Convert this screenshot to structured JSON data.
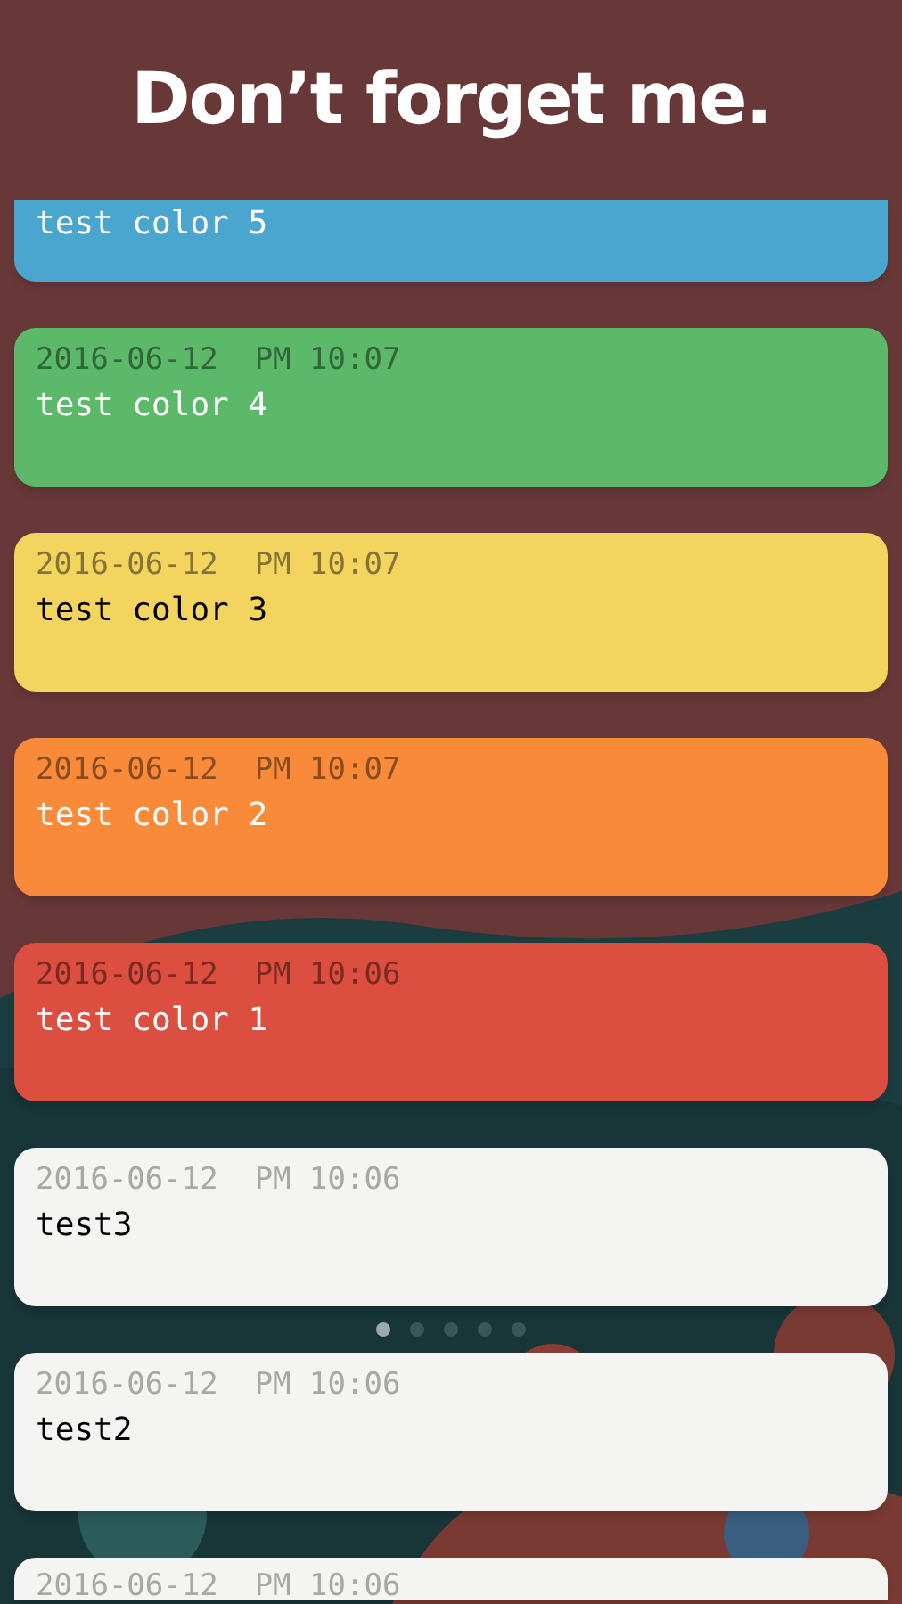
{
  "header": {
    "title": "Don’t forget me."
  },
  "notes": [
    {
      "text": "test color 5",
      "color": "#4ba6cf"
    },
    {
      "date": "2016-06-12  PM 10:07",
      "text": "test color 4",
      "color": "#5cb96a"
    },
    {
      "date": "2016-06-12  PM 10:07",
      "text": "test color 3",
      "color": "#f2d45e"
    },
    {
      "date": "2016-06-12  PM 10:07",
      "text": "test color 2",
      "color": "#f98a3a"
    },
    {
      "date": "2016-06-12  PM 10:06",
      "text": "test color 1",
      "color": "#dc4e40"
    },
    {
      "date": "2016-06-12  PM 10:06",
      "text": "test3",
      "color": "#f4f4f2"
    },
    {
      "date": "2016-06-12  PM 10:06",
      "text": "test2",
      "color": "#f4f4f2"
    },
    {
      "date": "2016-06-12  PM 10:06",
      "color": "#f4f4f2"
    }
  ],
  "page_dots": [
    {
      "selected": true
    },
    {
      "selected": false
    },
    {
      "selected": false
    },
    {
      "selected": false
    },
    {
      "selected": false
    }
  ]
}
